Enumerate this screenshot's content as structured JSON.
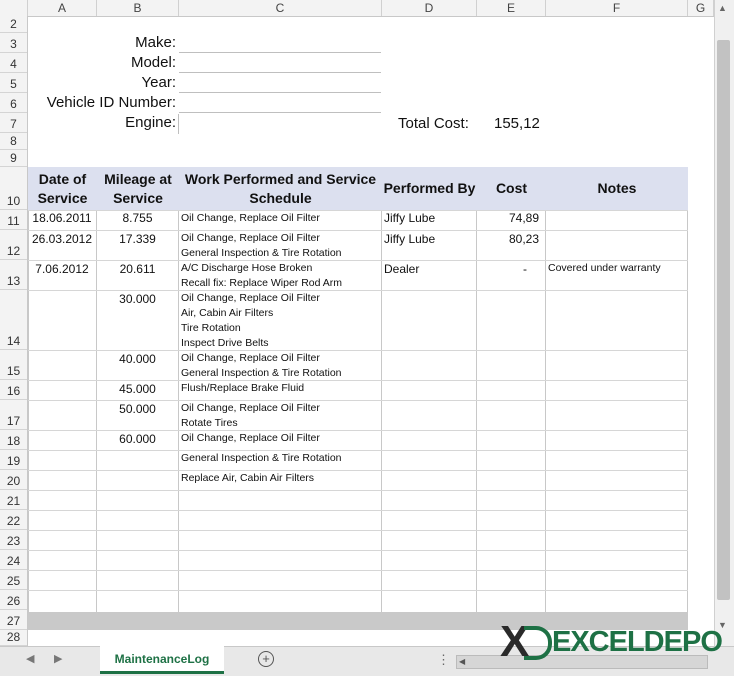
{
  "columns": [
    "A",
    "B",
    "C",
    "D",
    "E",
    "F",
    "G"
  ],
  "rows": [
    "2",
    "3",
    "4",
    "5",
    "6",
    "7",
    "8",
    "9",
    "10",
    "11",
    "12",
    "13",
    "14",
    "15",
    "16",
    "17",
    "18",
    "19",
    "20",
    "21",
    "22",
    "23",
    "24",
    "25",
    "26",
    "27",
    "28"
  ],
  "form": {
    "make_label": "Make:",
    "model_label": "Model:",
    "year_label": "Year:",
    "vin_label": "Vehicle ID Number:",
    "engine_label": "Engine:",
    "total_cost_label": "Total Cost:",
    "total_cost_value": "155,12"
  },
  "table_headers": {
    "date": "Date of Service",
    "mileage": "Mileage at Service",
    "work": "Work Performed and Service Schedule",
    "performed_by": "Performed By",
    "cost": "Cost",
    "notes": "Notes"
  },
  "entries": [
    {
      "date": "18.06.2011",
      "mileage": "8.755",
      "work1": "Oil Change, Replace Oil Filter",
      "work2": "",
      "work3": "",
      "work4": "",
      "by": "Jiffy Lube",
      "cost": "74,89",
      "notes": ""
    },
    {
      "date": "26.03.2012",
      "mileage": "17.339",
      "work1": "Oil Change, Replace Oil Filter",
      "work2": "General Inspection & Tire Rotation",
      "work3": "",
      "work4": "",
      "by": "Jiffy Lube",
      "cost": "80,23",
      "notes": ""
    },
    {
      "date": "7.06.2012",
      "mileage": "20.611",
      "work1": "A/C Discharge Hose Broken",
      "work2": "Recall fix: Replace Wiper Rod Arm",
      "work3": "",
      "work4": "",
      "by": "Dealer",
      "cost": "-",
      "notes": "Covered under warranty"
    },
    {
      "date": "",
      "mileage": "30.000",
      "work1": "Oil Change, Replace Oil Filter",
      "work2": "Air, Cabin Air Filters",
      "work3": "Tire Rotation",
      "work4": "Inspect Drive Belts",
      "by": "",
      "cost": "",
      "notes": ""
    },
    {
      "date": "",
      "mileage": "40.000",
      "work1": "Oil Change, Replace Oil Filter",
      "work2": "General Inspection & Tire Rotation",
      "work3": "",
      "work4": "",
      "by": "",
      "cost": "",
      "notes": ""
    },
    {
      "date": "",
      "mileage": "45.000",
      "work1": "Flush/Replace Brake Fluid",
      "work2": "",
      "work3": "",
      "work4": "",
      "by": "",
      "cost": "",
      "notes": ""
    },
    {
      "date": "",
      "mileage": "50.000",
      "work1": "Oil Change, Replace Oil Filter",
      "work2": "Rotate Tires",
      "work3": "",
      "work4": "",
      "by": "",
      "cost": "",
      "notes": ""
    },
    {
      "date": "",
      "mileage": "60.000",
      "work1": "Oil Change, Replace Oil Filter",
      "work2": "",
      "work3": "",
      "work4": "",
      "by": "",
      "cost": "",
      "notes": ""
    },
    {
      "date": "",
      "mileage": "",
      "work1": "General Inspection & Tire Rotation",
      "work2": "",
      "work3": "",
      "work4": "",
      "by": "",
      "cost": "",
      "notes": ""
    },
    {
      "date": "",
      "mileage": "",
      "work1": "Replace Air, Cabin Air Filters",
      "work2": "",
      "work3": "",
      "work4": "",
      "by": "",
      "cost": "",
      "notes": ""
    }
  ],
  "sheet_tab": "MaintenanceLog",
  "add_sheet_icon": "plus-circle-icon",
  "logo_text": "EXCELDEPO",
  "accent": "#1e7145"
}
